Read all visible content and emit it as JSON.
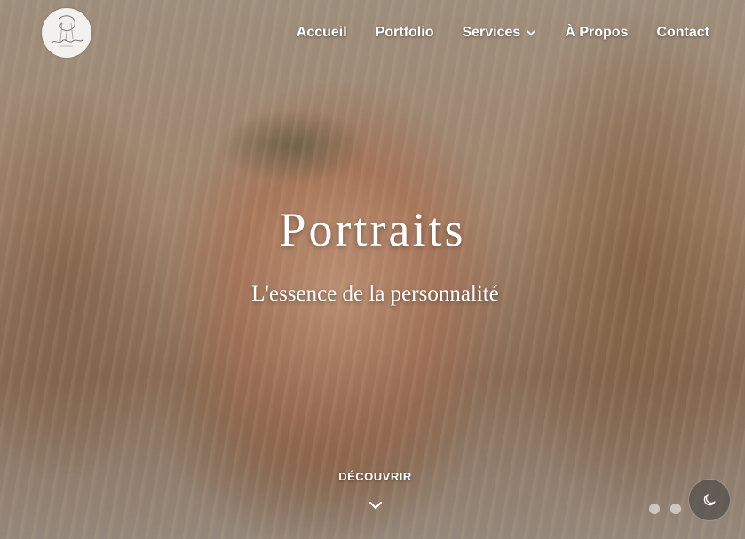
{
  "brand": {
    "logo_icon": "signature-logo-icon"
  },
  "nav": {
    "items": [
      {
        "label": "Accueil"
      },
      {
        "label": "Portfolio"
      },
      {
        "label": "Services",
        "icon": "chevron-down-icon"
      },
      {
        "label": "À Propos"
      },
      {
        "label": "Contact"
      }
    ]
  },
  "hero": {
    "title": "Portraits",
    "subtitle": "L'essence de la personnalité",
    "cta_label": "DÉCOUVRIR",
    "cta_icon": "chevron-down-icon",
    "slides_total": 2
  },
  "theme_toggle": {
    "icon": "moon-icon"
  }
}
